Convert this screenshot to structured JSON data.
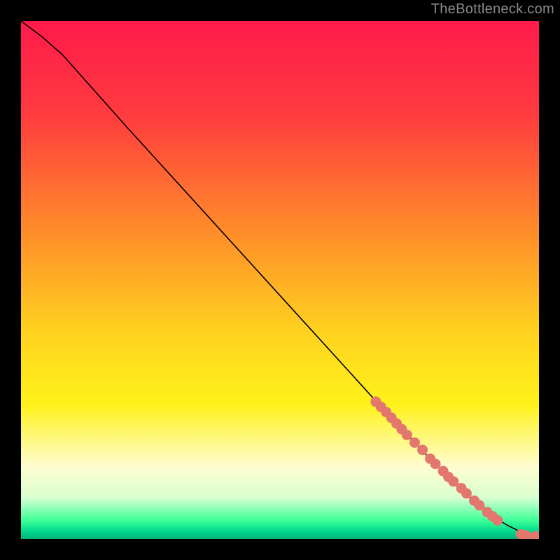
{
  "watermark": "TheBottleneck.com",
  "chart_data": {
    "type": "line",
    "title": "",
    "xlabel": "",
    "ylabel": "",
    "xlim": [
      0,
      100
    ],
    "ylim": [
      0,
      100
    ],
    "grid": false,
    "legend": false,
    "background_gradient": [
      {
        "stop": 0.0,
        "color": "#ff1a4b"
      },
      {
        "stop": 0.18,
        "color": "#ff3b3f"
      },
      {
        "stop": 0.4,
        "color": "#ff8a2a"
      },
      {
        "stop": 0.6,
        "color": "#ffd21f"
      },
      {
        "stop": 0.74,
        "color": "#fff21a"
      },
      {
        "stop": 0.86,
        "color": "#fffdd0"
      },
      {
        "stop": 0.92,
        "color": "#d8ffd0"
      },
      {
        "stop": 0.965,
        "color": "#3bff99"
      },
      {
        "stop": 0.985,
        "color": "#00d98c"
      },
      {
        "stop": 1.0,
        "color": "#00b37a"
      }
    ],
    "series": [
      {
        "name": "curve",
        "type": "line",
        "color": "#000000",
        "x": [
          0,
          4,
          8,
          12,
          20,
          30,
          40,
          50,
          60,
          70,
          78,
          84,
          88,
          90,
          92,
          94,
          96,
          97.5,
          99,
          100
        ],
        "y": [
          100,
          97,
          93.5,
          89,
          80,
          69,
          58,
          47,
          36,
          25,
          16.5,
          10.5,
          6.8,
          5.2,
          3.8,
          2.6,
          1.6,
          0.9,
          0.45,
          0.4
        ]
      },
      {
        "name": "markers",
        "type": "scatter",
        "color": "#e3776d",
        "points": [
          {
            "x": 68.5,
            "y": 26.5
          },
          {
            "x": 69.5,
            "y": 25.5
          },
          {
            "x": 70.5,
            "y": 24.5
          },
          {
            "x": 71.5,
            "y": 23.4
          },
          {
            "x": 72.5,
            "y": 22.3
          },
          {
            "x": 73.5,
            "y": 21.2
          },
          {
            "x": 74.5,
            "y": 20.1
          },
          {
            "x": 76.0,
            "y": 18.6
          },
          {
            "x": 77.5,
            "y": 17.2
          },
          {
            "x": 79.0,
            "y": 15.5
          },
          {
            "x": 80.0,
            "y": 14.5
          },
          {
            "x": 81.5,
            "y": 13.1
          },
          {
            "x": 82.5,
            "y": 12.0
          },
          {
            "x": 83.5,
            "y": 11.1
          },
          {
            "x": 85.0,
            "y": 9.8
          },
          {
            "x": 86.0,
            "y": 8.8
          },
          {
            "x": 87.5,
            "y": 7.4
          },
          {
            "x": 88.5,
            "y": 6.5
          },
          {
            "x": 90.0,
            "y": 5.2
          },
          {
            "x": 91.0,
            "y": 4.4
          },
          {
            "x": 92.0,
            "y": 3.6
          },
          {
            "x": 96.5,
            "y": 0.9
          },
          {
            "x": 97.5,
            "y": 0.7
          },
          {
            "x": 99.3,
            "y": 0.5
          },
          {
            "x": 100.0,
            "y": 0.4
          }
        ]
      }
    ]
  }
}
